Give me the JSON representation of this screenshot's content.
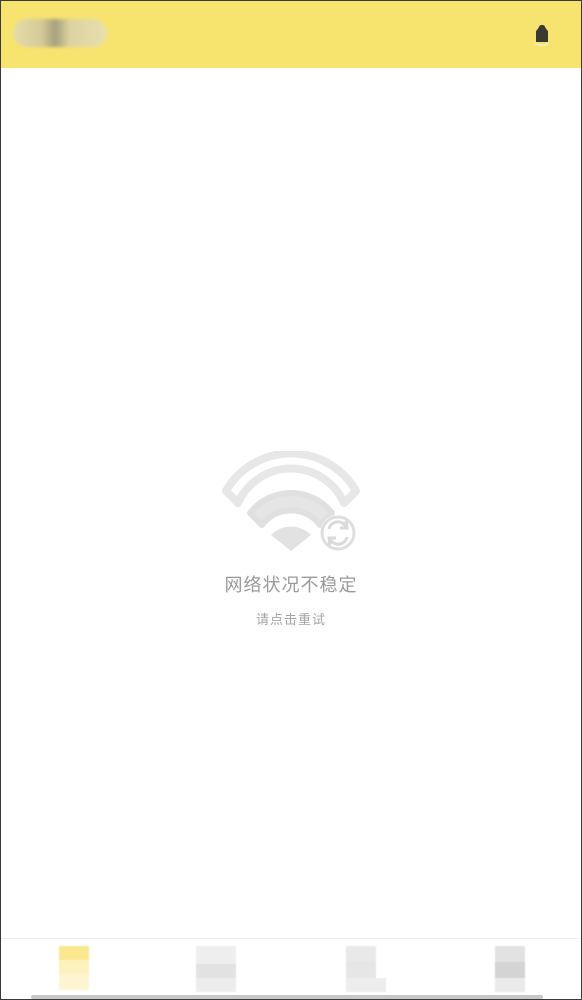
{
  "header": {
    "title_placeholder": "blurred-title",
    "icon": "notification-bell-icon",
    "background_color": "#f7e46e"
  },
  "error": {
    "icon": "wifi-refresh-icon",
    "title": "网络状况不稳定",
    "hint": "请点击重试",
    "text_color": "#9a9a9a"
  },
  "bottom_nav": {
    "items": [
      {
        "name": "nav-item-home",
        "active": true
      },
      {
        "name": "nav-item-2",
        "active": false
      },
      {
        "name": "nav-item-3",
        "active": false
      },
      {
        "name": "nav-item-4",
        "active": false
      }
    ],
    "active_color": "#fbe88e"
  }
}
